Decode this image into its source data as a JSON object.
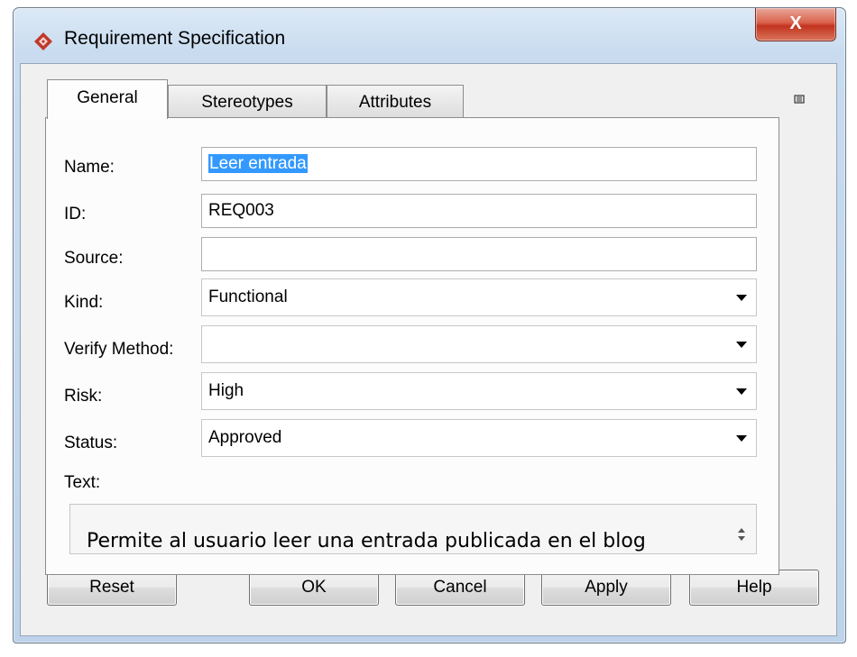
{
  "window": {
    "title": "Requirement Specification",
    "close_label": "X"
  },
  "tabs": [
    {
      "label": "General",
      "active": true
    },
    {
      "label": "Stereotypes",
      "active": false
    },
    {
      "label": "Attributes",
      "active": false
    }
  ],
  "form": {
    "name_label": "Name:",
    "name_value": "Leer entrada",
    "id_label": "ID:",
    "id_value": "REQ003",
    "source_label": "Source:",
    "source_value": "",
    "kind_label": "Kind:",
    "kind_value": "Functional",
    "verify_label": "Verify Method:",
    "verify_value": "",
    "risk_label": "Risk:",
    "risk_value": "High",
    "status_label": "Status:",
    "status_value": "Approved",
    "text_label": "Text:",
    "text_value": "Permite al usuario leer una entrada publicada en el blog"
  },
  "buttons": {
    "reset": "Reset",
    "ok": "OK",
    "cancel": "Cancel",
    "apply": "Apply",
    "help": "Help"
  },
  "icons": {
    "app": "requirement-diamond-icon",
    "corner": "panel-options-icon"
  },
  "colors": {
    "selection": "#3399ff",
    "close_button": "#c2331f",
    "title_bar": "#c9dcef"
  }
}
